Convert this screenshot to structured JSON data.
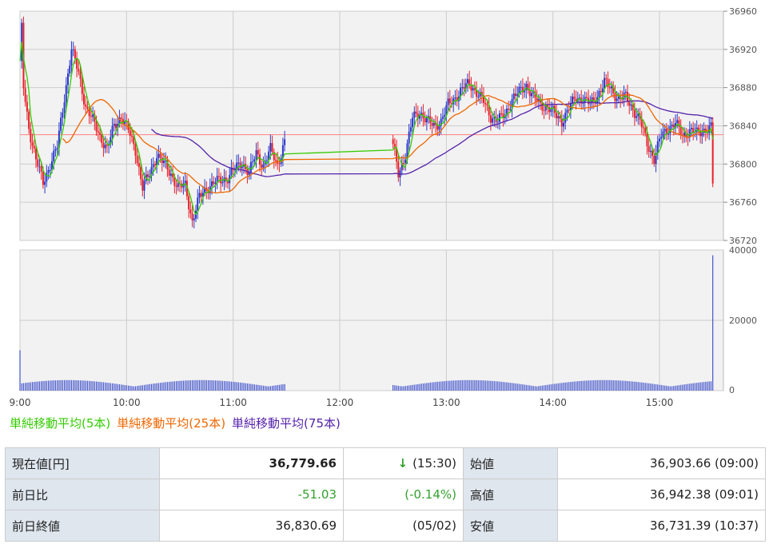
{
  "chart_data": {
    "type": "candlestick",
    "x_ticks": [
      "9:00",
      "10:00",
      "11:00",
      "12:00",
      "13:00",
      "14:00",
      "15:00"
    ],
    "price_axis": {
      "ylim": [
        36720,
        36960
      ],
      "ticks": [
        "36960",
        "36920",
        "36880",
        "36840",
        "36800",
        "36760",
        "36720"
      ]
    },
    "volume_axis": {
      "ylim": [
        0,
        40000
      ],
      "ticks": [
        "40000",
        "20000",
        "0"
      ]
    },
    "reference_line": 36830.69,
    "series": [
      {
        "name": "単純移動平均(5本)",
        "color": "#33cc00"
      },
      {
        "name": "単純移動平均(25本)",
        "color": "#ee6600"
      },
      {
        "name": "単純移動平均(75本)",
        "color": "#5522aa"
      }
    ],
    "price_path": [
      [
        "9:00",
        36903
      ],
      [
        "9:01",
        36942
      ],
      [
        "9:02",
        36880
      ],
      [
        "9:05",
        36838
      ],
      [
        "9:09",
        36805
      ],
      [
        "9:13",
        36780
      ],
      [
        "9:17",
        36800
      ],
      [
        "9:21",
        36818
      ],
      [
        "9:25",
        36870
      ],
      [
        "9:29",
        36920
      ],
      [
        "9:33",
        36895
      ],
      [
        "9:37",
        36860
      ],
      [
        "9:41",
        36845
      ],
      [
        "9:45",
        36830
      ],
      [
        "9:49",
        36815
      ],
      [
        "9:53",
        36840
      ],
      [
        "9:57",
        36850
      ],
      [
        "10:01",
        36835
      ],
      [
        "10:05",
        36815
      ],
      [
        "10:09",
        36775
      ],
      [
        "10:13",
        36790
      ],
      [
        "10:17",
        36810
      ],
      [
        "10:21",
        36800
      ],
      [
        "10:25",
        36790
      ],
      [
        "10:29",
        36775
      ],
      [
        "10:33",
        36778
      ],
      [
        "10:37",
        36740
      ],
      [
        "10:41",
        36765
      ],
      [
        "10:45",
        36775
      ],
      [
        "10:49",
        36780
      ],
      [
        "10:53",
        36783
      ],
      [
        "10:57",
        36786
      ],
      [
        "11:01",
        36795
      ],
      [
        "11:05",
        36802
      ],
      [
        "11:09",
        36790
      ],
      [
        "11:13",
        36812
      ],
      [
        "11:17",
        36798
      ],
      [
        "11:21",
        36815
      ],
      [
        "11:25",
        36800
      ],
      [
        "11:30",
        36828
      ],
      [
        "12:30",
        36820
      ],
      [
        "12:33",
        36790
      ],
      [
        "12:37",
        36810
      ],
      [
        "12:41",
        36848
      ],
      [
        "12:45",
        36855
      ],
      [
        "12:49",
        36845
      ],
      [
        "12:53",
        36840
      ],
      [
        "12:57",
        36845
      ],
      [
        "13:01",
        36862
      ],
      [
        "13:05",
        36870
      ],
      [
        "13:09",
        36878
      ],
      [
        "13:13",
        36885
      ],
      [
        "13:17",
        36875
      ],
      [
        "13:21",
        36865
      ],
      [
        "13:25",
        36850
      ],
      [
        "13:29",
        36845
      ],
      [
        "13:33",
        36852
      ],
      [
        "13:37",
        36868
      ],
      [
        "13:41",
        36875
      ],
      [
        "13:45",
        36883
      ],
      [
        "13:49",
        36870
      ],
      [
        "13:53",
        36862
      ],
      [
        "13:57",
        36860
      ],
      [
        "14:01",
        36852
      ],
      [
        "14:05",
        36845
      ],
      [
        "14:09",
        36858
      ],
      [
        "14:13",
        36870
      ],
      [
        "14:17",
        36868
      ],
      [
        "14:21",
        36862
      ],
      [
        "14:25",
        36872
      ],
      [
        "14:29",
        36885
      ],
      [
        "14:33",
        36878
      ],
      [
        "14:37",
        36868
      ],
      [
        "14:41",
        36870
      ],
      [
        "14:45",
        36858
      ],
      [
        "14:49",
        36845
      ],
      [
        "14:53",
        36822
      ],
      [
        "14:57",
        36805
      ],
      [
        "15:01",
        36830
      ],
      [
        "15:05",
        36838
      ],
      [
        "15:09",
        36842
      ],
      [
        "15:13",
        36830
      ],
      [
        "15:17",
        36835
      ],
      [
        "15:21",
        36832
      ],
      [
        "15:25",
        36836
      ],
      [
        "15:29",
        36838
      ],
      [
        "15:30",
        36779.66
      ]
    ],
    "volume_spikes": [
      [
        "9:00",
        11500
      ],
      [
        "15:30",
        38500
      ]
    ]
  },
  "legend": {
    "ma5": "単純移動平均(5本)",
    "ma25": "単純移動平均(25本)",
    "ma75": "単純移動平均(75本)"
  },
  "quote": {
    "current_label": "現在値[円]",
    "current_value": "36,779.66",
    "current_arrow": "↓",
    "current_time": "(15:30)",
    "change_label": "前日比",
    "change_value": "-51.03",
    "change_pct": "(-0.14%)",
    "prev_close_label": "前日終値",
    "prev_close_value": "36,830.69",
    "prev_close_date": "(05/02)",
    "open_label": "始値",
    "open_value": "36,903.66 (09:00)",
    "high_label": "高値",
    "high_value": "36,942.38 (09:01)",
    "low_label": "安値",
    "low_value": "36,731.39 (10:37)"
  },
  "colors": {
    "up": "#2a38c8",
    "down": "#e8202a",
    "ma5": "#33cc00",
    "ma25": "#ee6600",
    "ma75": "#5522aa",
    "ref_line": "#ff8080",
    "volume": "#4455cc",
    "green_text": "#33a02c"
  }
}
